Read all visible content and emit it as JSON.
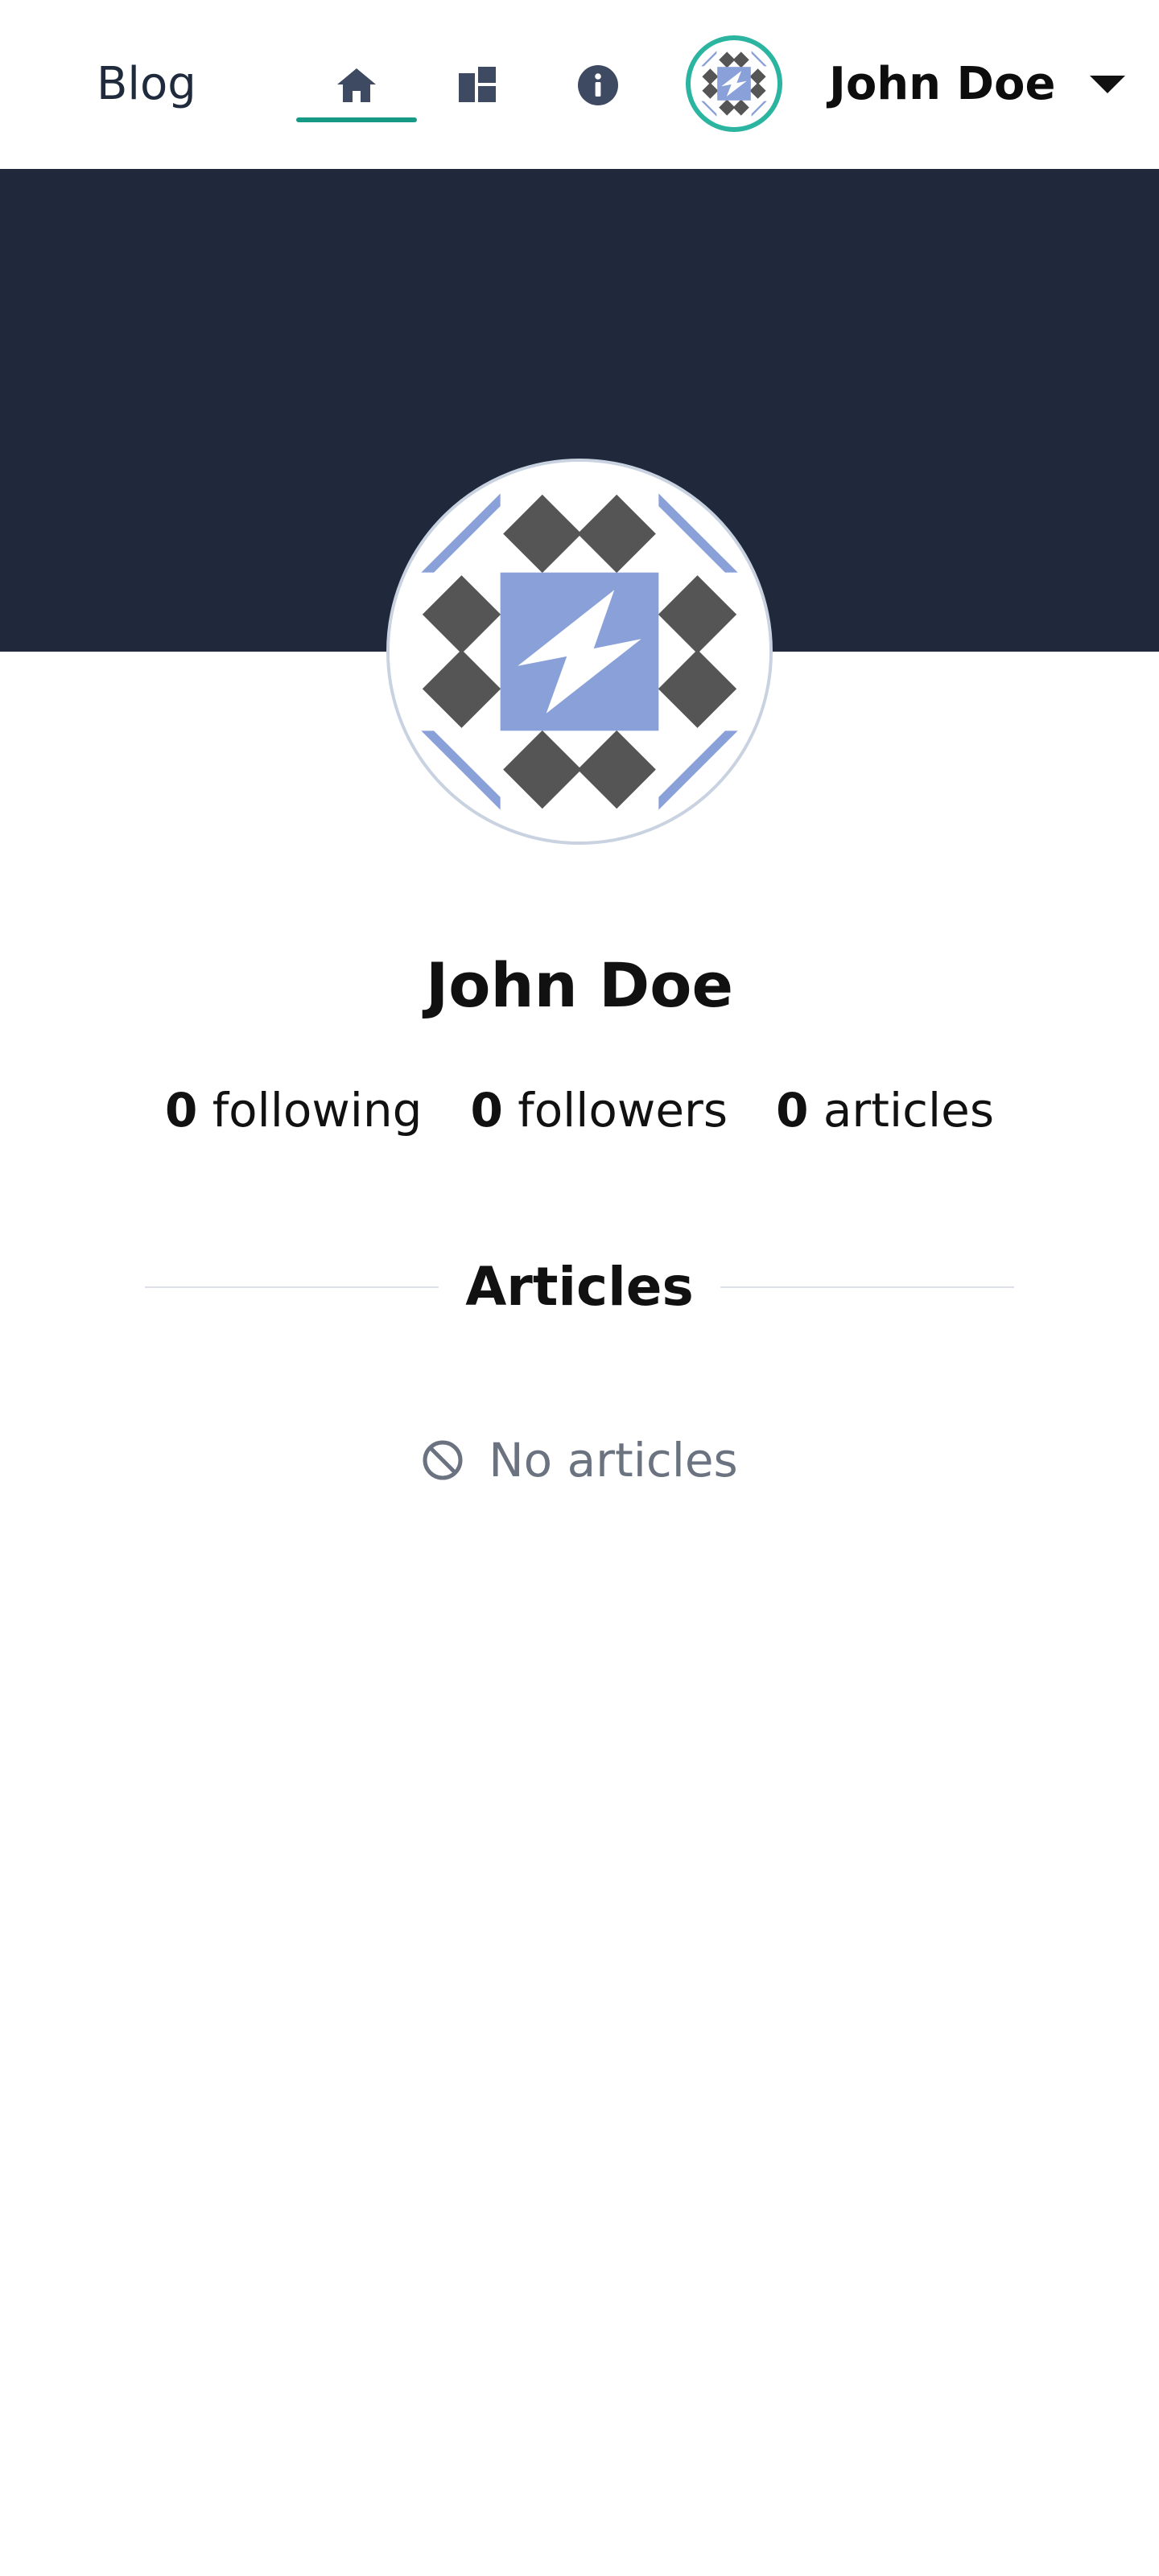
{
  "navbar": {
    "brand": "Blog",
    "nav_items": [
      {
        "icon": "home-icon",
        "active": true
      },
      {
        "icon": "dashboard-icon",
        "active": false
      },
      {
        "icon": "info-icon",
        "active": false
      }
    ],
    "username": "John Doe",
    "accent_color": "#169a86"
  },
  "banner": {
    "color": "#1f293b"
  },
  "profile": {
    "name": "John Doe",
    "stats": [
      {
        "count": "0",
        "label": "following"
      },
      {
        "count": "0",
        "label": "followers"
      },
      {
        "count": "0",
        "label": "articles"
      }
    ]
  },
  "articles": {
    "heading": "Articles",
    "empty_text": "No articles",
    "empty_icon": "ban-icon"
  }
}
